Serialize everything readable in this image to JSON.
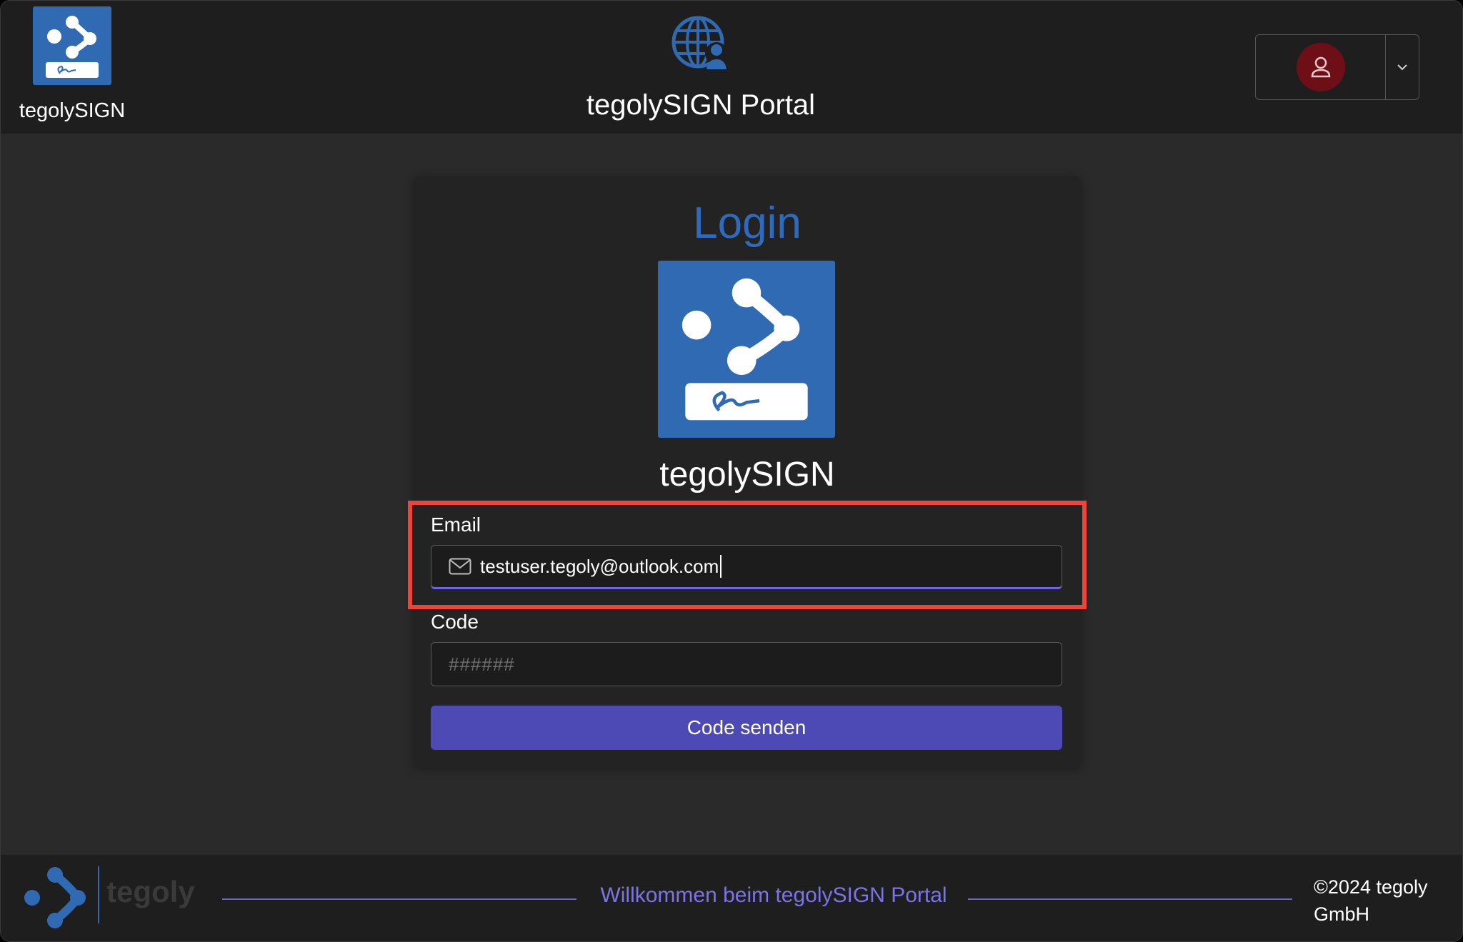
{
  "header": {
    "brand_name": "tegolySIGN",
    "portal_title": "tegolySIGN Portal"
  },
  "login": {
    "title": "Login",
    "brand_name": "tegolySIGN",
    "email_label": "Email",
    "email_value": "testuser.tegoly@outlook.com",
    "code_label": "Code",
    "code_placeholder": "######",
    "send_button": "Code senden"
  },
  "footer": {
    "company": "tegoly",
    "welcome": "Willkommen beim tegolySIGN Portal",
    "copyright": "©2024 tegoly GmbH"
  },
  "icons": {
    "brand": "tegolysign-logo-icon",
    "portal": "globe-user-icon",
    "avatar": "user-icon",
    "menu": "chevron-down-icon",
    "email": "mail-icon"
  },
  "colors": {
    "brand_blue": "#2f6ab3",
    "login_title": "#2e6bbd",
    "primary_button": "#4d4ab5",
    "highlight": "#f0443a",
    "avatar_bg": "#6e0f17",
    "welcome_text": "#7b74e6"
  }
}
